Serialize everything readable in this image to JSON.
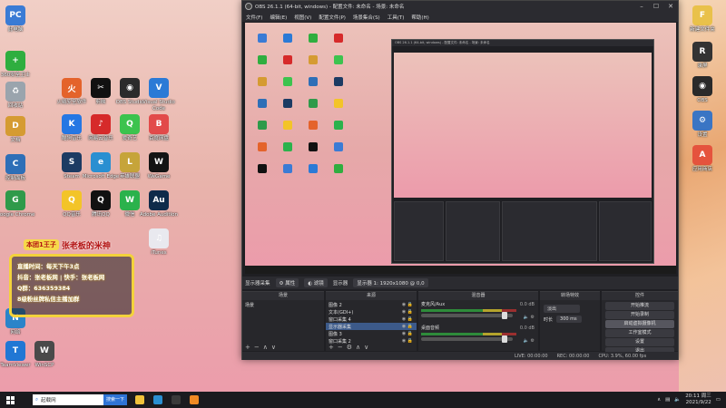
{
  "desktop_icons": [
    {
      "label": "此电脑",
      "color": "#3a7bd5",
      "glyph": "PC"
    },
    {
      "label": "360安全卫士",
      "color": "#2fae3f",
      "glyph": "+"
    },
    {
      "label": "回收站",
      "color": "#9aa4ad",
      "glyph": "♻"
    },
    {
      "label": "文档",
      "color": "#d59b32",
      "glyph": "D"
    },
    {
      "label": "控制面板",
      "color": "#2e6fb7",
      "glyph": "C"
    },
    {
      "label": "Google Chrome",
      "color": "#2f9a4a",
      "glyph": "G"
    },
    {
      "label": "网络",
      "color": "#2b84c9",
      "glyph": "N"
    }
  ],
  "desktop_grid_icons": [
    {
      "label": "火绒安全软件",
      "color": "#e4632b",
      "glyph": "火"
    },
    {
      "label": "剪映",
      "color": "#111111",
      "glyph": "✂"
    },
    {
      "label": "OBS Studio",
      "color": "#2b2b2b",
      "glyph": "◉"
    },
    {
      "label": "Visual Studio Code",
      "color": "#2b7ad6",
      "glyph": "V"
    },
    {
      "label": "酷狗音乐",
      "color": "#2577e3",
      "glyph": "K"
    },
    {
      "label": "网易云音乐",
      "color": "#d62a2a",
      "glyph": "♪"
    },
    {
      "label": "爱奇艺",
      "color": "#3cc34e",
      "glyph": "Q"
    },
    {
      "label": "百度网盘",
      "color": "#e24a4a",
      "glyph": "B"
    },
    {
      "label": "Steam",
      "color": "#1c3b63",
      "glyph": "S"
    },
    {
      "label": "Microsoft Edge",
      "color": "#2a8fd1",
      "glyph": "e"
    },
    {
      "label": "英雄联盟",
      "color": "#c6a43a",
      "glyph": "L"
    },
    {
      "label": "WeGame",
      "color": "#141414",
      "glyph": "W"
    },
    {
      "label": "QQ音乐",
      "color": "#f3c428",
      "glyph": "Q"
    },
    {
      "label": "腾讯QQ",
      "color": "#111111",
      "glyph": "Q"
    },
    {
      "label": "微信",
      "color": "#2bb24c",
      "glyph": "W"
    },
    {
      "label": "Adobe Audition",
      "color": "#0f2b4a",
      "glyph": "Au"
    },
    {
      "label": "iTunes",
      "color": "#e9e9ef",
      "glyph": "♫"
    },
    {
      "label": "TeamViewer",
      "color": "#2177d4",
      "glyph": "T"
    },
    {
      "label": "WinSCP",
      "color": "#4a4a4a",
      "glyph": "W"
    }
  ],
  "desktop_right_icons": [
    {
      "label": "新建文件夹",
      "color": "#e9c14a",
      "glyph": "F"
    },
    {
      "label": "录屏",
      "color": "#333333",
      "glyph": "R"
    },
    {
      "label": "OBS",
      "color": "#2a2a2a",
      "glyph": "◉"
    },
    {
      "label": "设置",
      "color": "#3a75c4",
      "glyph": "⚙"
    },
    {
      "label": "应用商店",
      "color": "#e5533d",
      "glyph": "A"
    }
  ],
  "stream_card": {
    "badge": "本团1王子",
    "name": "张老板的米神",
    "lines": [
      "直播时间：每天下午3点",
      "抖音：张老板网 | 快手：张老板网",
      "Q群：636359384",
      "8级粉丝牌私信主播加群"
    ]
  },
  "obs": {
    "title": "OBS 26.1.1 (64-bit, windows) - 配置文件: 未命名 - 场景: 未命名",
    "menu": [
      "文件(F)",
      "编辑(E)",
      "视图(V)",
      "配置文件(P)",
      "场景集合(S)",
      "工具(T)",
      "帮助(H)"
    ],
    "source_toolbar": {
      "selected": "显示器采集",
      "properties": "属性",
      "filters": "滤镜",
      "display_label": "显示器",
      "display_value": "显示器 1: 1920x1080 @ 0,0"
    },
    "docks": {
      "scenes": "场景",
      "sources": "来源",
      "mixer": "混音器",
      "transitions": "转场特效",
      "controls": "控件"
    },
    "scenes": [
      "场景"
    ],
    "sources": [
      "图像 2",
      "文本(GDI+)",
      "窗口采集 4",
      "显示器采集",
      "图像 3",
      "窗口采集 2"
    ],
    "mixer": [
      {
        "name": "麦克风/Aux",
        "db": "0.0 dB"
      },
      {
        "name": "桌面音频",
        "db": "0.0 dB"
      }
    ],
    "transition": {
      "type": "淡出",
      "duration_label": "时长",
      "duration": "300 ms"
    },
    "controls": [
      "开始推流",
      "开始录制",
      "启动虚拟摄像机",
      "工作室模式",
      "设置",
      "退出"
    ],
    "status": {
      "live": "LIVE: 00:00:00",
      "rec": "REC: 00:00:00",
      "cpu": "CPU: 3.9%, 60.00 fps"
    }
  },
  "taskbar": {
    "search_placeholder": "起载网",
    "search_button": "搜索一下",
    "time": "20:11 周三",
    "date": "2021/9/22",
    "apps": [
      {
        "name": "file-explorer",
        "color": "#f0c23a"
      },
      {
        "name": "edge",
        "color": "#2a8fd1"
      },
      {
        "name": "obs",
        "color": "#3a3a3a"
      },
      {
        "name": "sublime",
        "color": "#f08a24"
      }
    ]
  }
}
